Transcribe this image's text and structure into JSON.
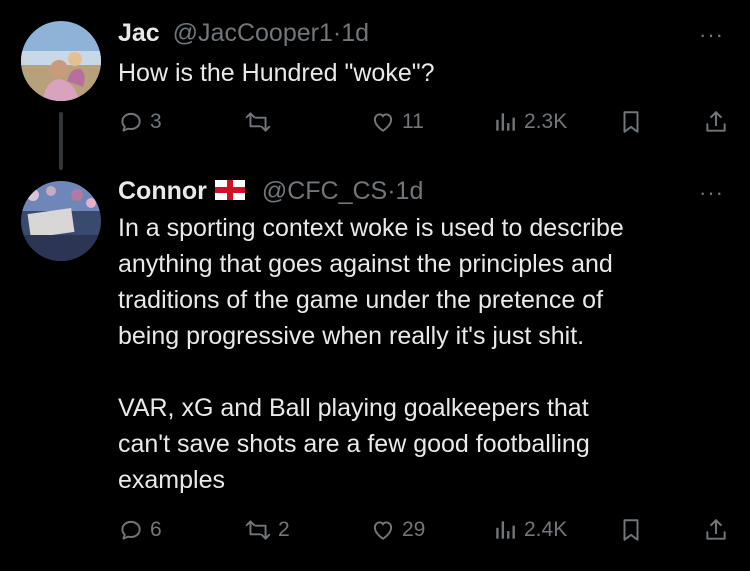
{
  "tweets": [
    {
      "name": "Jac",
      "handle": "@JacCooper1",
      "separator": "·",
      "time": "1d",
      "more": "···",
      "text": "How is the Hundred \"woke\"?",
      "replies": "3",
      "retweets": "",
      "likes": "11",
      "views": "2.3K"
    },
    {
      "name": "Connor",
      "flag": "england-flag",
      "handle": "@CFC_CS",
      "separator": "·",
      "time": "1d",
      "more": "···",
      "text": "In a sporting context woke is used to describe\nanything that goes against the principles and\ntraditions of the game under the pretence of\nbeing progressive when really it's just shit.\n\nVAR, xG and Ball playing goalkeepers that\ncan't save shots are a few good footballing\nexamples",
      "replies": "6",
      "retweets": "2",
      "likes": "29",
      "views": "2.4K"
    }
  ],
  "colors": {
    "background": "#000000",
    "text": "#e7e9ea",
    "muted": "#71767b",
    "thread_line": "#333639"
  },
  "icons": [
    "reply-icon",
    "retweet-icon",
    "like-icon",
    "views-icon",
    "bookmark-icon",
    "share-icon",
    "more-icon"
  ]
}
